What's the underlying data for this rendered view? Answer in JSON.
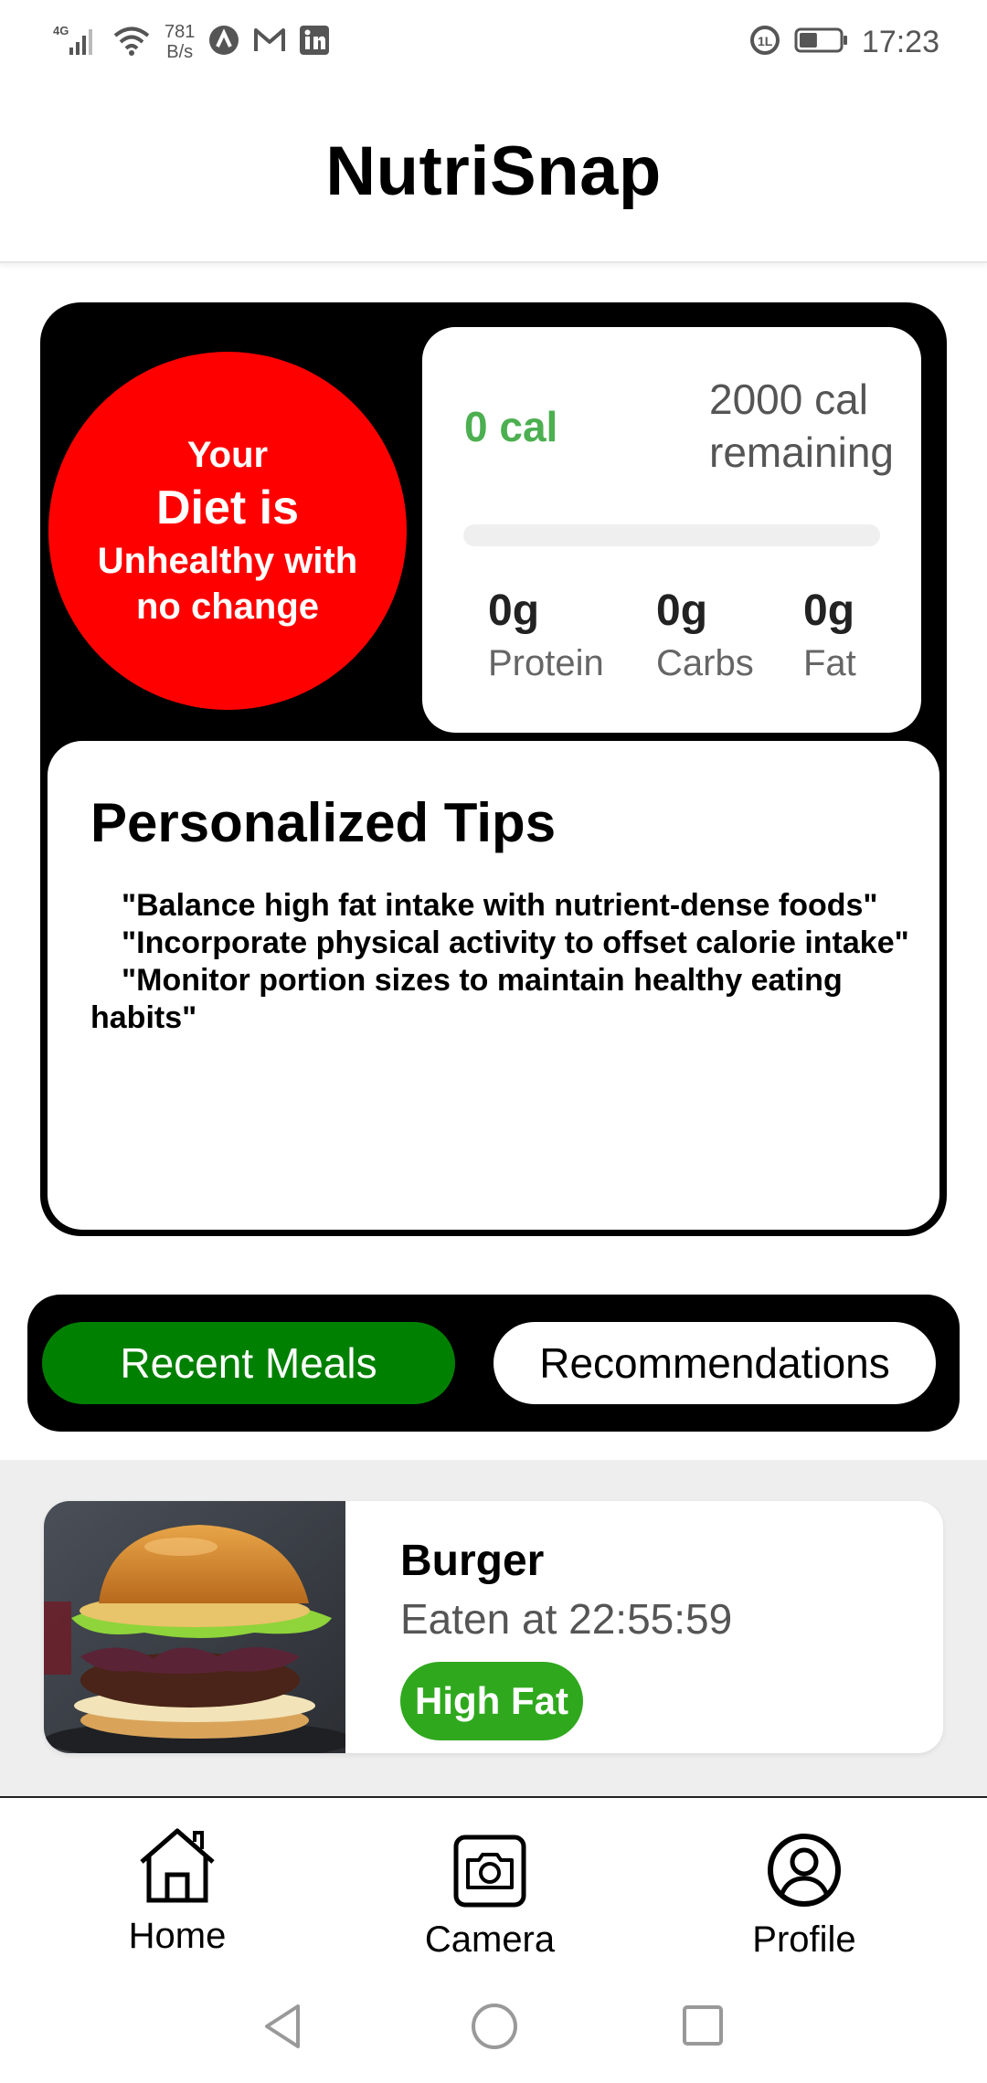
{
  "status_bar": {
    "network": "4G",
    "speed_value": "781",
    "speed_unit": "B/s",
    "time": "17:23",
    "battery_level_percent": 45
  },
  "header": {
    "title": "NutriSnap"
  },
  "diet_status": {
    "line1": "Your",
    "line2": "Diet is",
    "line3": "Unhealthy  with no change",
    "color": "#ff0000"
  },
  "calories": {
    "eaten": "0 cal",
    "remaining_value": "2000 cal",
    "remaining_label": "remaining",
    "progress_fraction": 0,
    "accent": "#4caf50"
  },
  "macros": [
    {
      "value": "0g",
      "label": "Protein"
    },
    {
      "value": "0g",
      "label": "Carbs"
    },
    {
      "value": "0g",
      "label": "Fat"
    }
  ],
  "tips": {
    "title": "Personalized Tips",
    "items": [
      "\"Balance high fat intake with nutrient-dense foods\"",
      "\"Incorporate physical activity to offset calorie intake\"",
      "\"Monitor portion sizes to maintain healthy eating habits\""
    ]
  },
  "tabs": [
    {
      "label": "Recent Meals",
      "active": true,
      "color": "#008000"
    },
    {
      "label": "Recommendations",
      "active": false
    }
  ],
  "meals": [
    {
      "name": "Burger",
      "time": "Eaten at 22:55:59",
      "tag": "High Fat",
      "tag_color": "#2fa81d"
    }
  ],
  "bottom_nav": [
    {
      "label": "Home",
      "icon": "home-icon"
    },
    {
      "label": "Camera",
      "icon": "camera-icon"
    },
    {
      "label": "Profile",
      "icon": "profile-icon"
    }
  ]
}
